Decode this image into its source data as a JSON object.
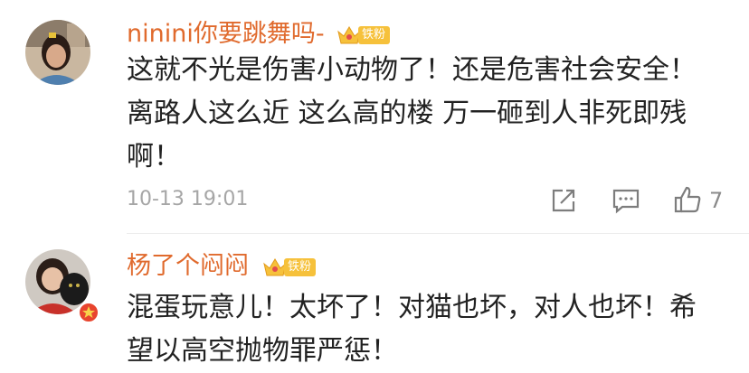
{
  "comments": [
    {
      "username": "ninini你要跳舞吗-",
      "badge_label": "铁粉",
      "text_lines": [
        "这就不光是伤害小动物了！还是危害社会安全！",
        "离路人这么近 这么高的楼 万一砸到人非死即残",
        "啊！"
      ],
      "timestamp": "10-13 19:01",
      "likes": "7"
    },
    {
      "username": "杨了个闷闷",
      "badge_label": "铁粉",
      "text_lines": [
        "混蛋玩意儿！太坏了！对猫也坏，对人也坏！希",
        "望以高空抛物罪严惩！"
      ]
    }
  ],
  "colors": {
    "username": "#e06a2d",
    "badge": "#f6c13b",
    "text": "#222222",
    "meta": "#a6a6a6"
  },
  "icons": [
    "share-icon",
    "comment-icon",
    "like-icon",
    "verified-badge-icon"
  ]
}
